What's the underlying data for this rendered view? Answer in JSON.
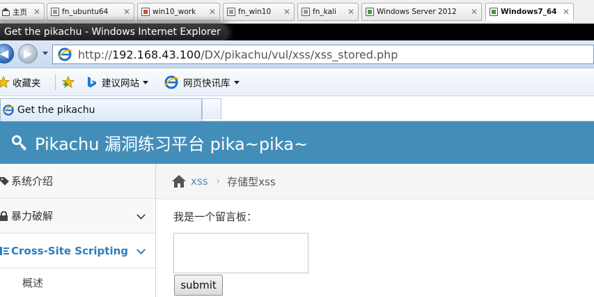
{
  "vm_tabs": [
    {
      "label": "主页",
      "icon": "home-icon"
    },
    {
      "label": "fn_ubuntu64",
      "icon": "vm-icon"
    },
    {
      "label": "win10_work",
      "icon": "vm-icon"
    },
    {
      "label": "fn_win10",
      "icon": "vm-icon"
    },
    {
      "label": "fn_kali",
      "icon": "vm-icon"
    },
    {
      "label": "Windows Server 2012",
      "icon": "vm-icon"
    },
    {
      "label": "Windows7_64",
      "icon": "vm-icon",
      "active": true
    }
  ],
  "browser": {
    "window_title": "Get the pikachu - Windows Internet Explorer",
    "url_prefix": "http://",
    "url_host": "192.168.43.100",
    "url_path": "/DX/pikachu/vul/xss/xss_stored.php",
    "favorites": {
      "favorites_label": "收藏夹",
      "suggested_sites_label": "建议网站",
      "web_slice_label": "网页快讯库"
    },
    "tab_title": "Get the pikachu"
  },
  "page": {
    "header_title": "Pikachu 漏洞练习平台 pika~pika~",
    "header_color": "#438eb9",
    "sidebar": {
      "items": [
        {
          "label": "系统介绍",
          "icon": "tags-icon"
        },
        {
          "label": "暴力破解",
          "icon": "lock-icon"
        },
        {
          "label": "Cross-Site Scripting",
          "icon": "list-icon",
          "active": true
        }
      ],
      "sub_item": "概述"
    },
    "breadcrumb": {
      "home_icon": "home-icon",
      "parent": "xss",
      "current": "存储型xss"
    },
    "board_label": "我是一个留言板：",
    "message_value": "",
    "submit_label": "submit"
  }
}
